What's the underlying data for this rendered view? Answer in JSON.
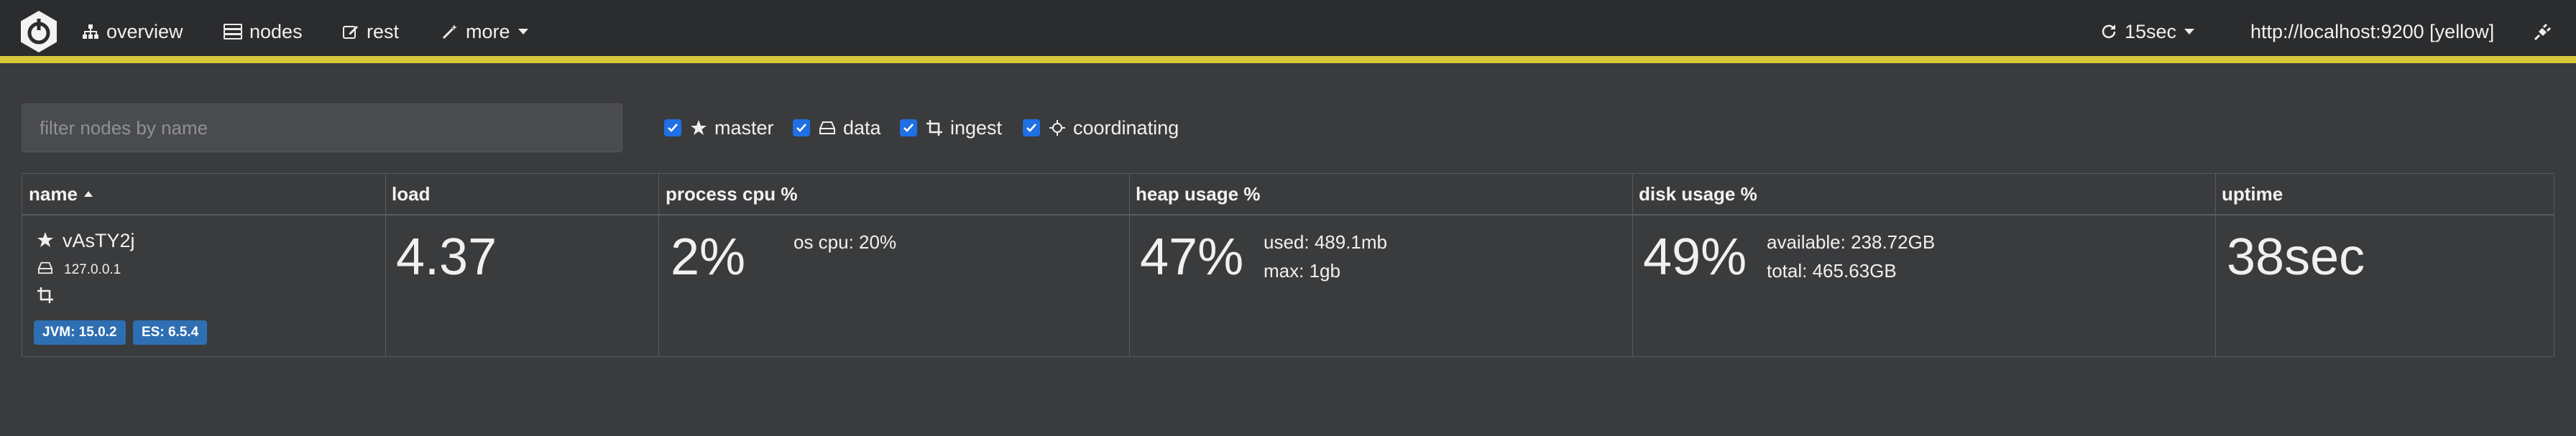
{
  "nav": {
    "overview": "overview",
    "nodes": "nodes",
    "rest": "rest",
    "more": "more",
    "refresh": "15sec",
    "cluster": "http://localhost:9200 [yellow]"
  },
  "filter": {
    "placeholder": "filter nodes by name"
  },
  "roles": [
    {
      "label": "master",
      "checked": true
    },
    {
      "label": "data",
      "checked": true
    },
    {
      "label": "ingest",
      "checked": true
    },
    {
      "label": "coordinating",
      "checked": true
    }
  ],
  "table": {
    "headers": [
      "name",
      "load",
      "process cpu %",
      "heap usage %",
      "disk usage %",
      "uptime"
    ],
    "row": {
      "name": "vAsTY2j",
      "ip": "127.0.0.1",
      "jvm": "JVM: 15.0.2",
      "es": "ES: 6.5.4",
      "load": "4.37",
      "cpu": "2%",
      "os_cpu": "os cpu: 20%",
      "heap": "47%",
      "heap_used": "used: 489.1mb",
      "heap_max": "max: 1gb",
      "disk": "49%",
      "disk_available": "available: 238.72GB",
      "disk_total": "total: 465.63GB",
      "uptime": "38sec"
    }
  },
  "colors": {
    "accent": "#d8c93a",
    "checkbox": "#1f6fe5",
    "badge": "#2e6fb3",
    "topbar": "#2b2c2e",
    "background": "#3a3b3d"
  }
}
